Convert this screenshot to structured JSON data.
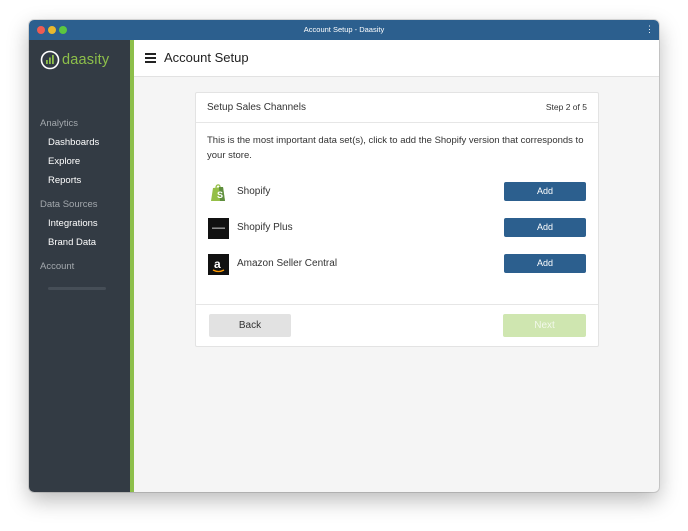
{
  "window": {
    "title": "Account Setup - Daasity"
  },
  "sidebar": {
    "logo_text": "daasity",
    "sections": [
      {
        "label": "Analytics",
        "items": [
          {
            "label": "Dashboards"
          },
          {
            "label": "Explore"
          },
          {
            "label": "Reports"
          }
        ]
      },
      {
        "label": "Data Sources",
        "items": [
          {
            "label": "Integrations"
          },
          {
            "label": "Brand Data"
          }
        ]
      },
      {
        "label": "Account",
        "items": []
      }
    ]
  },
  "header": {
    "title": "Account Setup"
  },
  "card": {
    "title": "Setup Sales Channels",
    "step": "Step 2 of 5",
    "instructions": "This is the most important data set(s), click to add the Shopify version that corresponds to your store.",
    "channels": [
      {
        "name": "Shopify",
        "icon": "shopify-bag-icon",
        "button": "Add"
      },
      {
        "name": "Shopify Plus",
        "icon": "shopify-plus-icon",
        "button": "Add"
      },
      {
        "name": "Amazon Seller Central",
        "icon": "amazon-icon",
        "button": "Add"
      }
    ],
    "back_label": "Back",
    "next_label": "Next"
  },
  "colors": {
    "titlebar": "#2c5f8e",
    "sidebar": "#333b44",
    "accent": "#8dbf4a",
    "primary_button": "#2c5f8e",
    "next_disabled": "#cfe6b0"
  }
}
